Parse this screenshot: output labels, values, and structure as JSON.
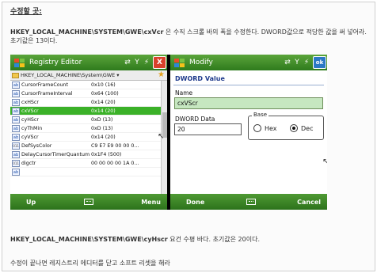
{
  "heading": "수정할 곳:",
  "para1_path": "HKEY_LOCAL_MACHINE\\SYSTEM\\GWE\\cxVcr",
  "para1_text": " 은 수직 스크롤 바의 폭을 수정한다. DWORD값으로 적당한 값을 써 넣어라. 초기값은 13이다.",
  "left_phone": {
    "title": "Registry Editor",
    "status_icons": [
      "⇄",
      "Y",
      "⚡"
    ],
    "close_label": "X",
    "path": "HKEY_LOCAL_MACHINE\\System\\GWE",
    "rows": [
      {
        "icon": "ab",
        "name": "CursorFrameCount",
        "value": "0x10 (16)",
        "selected": false
      },
      {
        "icon": "ab",
        "name": "CursorFrameInterval",
        "value": "0x64 (100)",
        "selected": false
      },
      {
        "icon": "ab",
        "name": "cxHScr",
        "value": "0x14 (20)",
        "selected": false
      },
      {
        "icon": "ab",
        "name": "cxVScr",
        "value": "0x14 (20)",
        "selected": true
      },
      {
        "icon": "ab",
        "name": "cyHScr",
        "value": "0xD (13)",
        "selected": false
      },
      {
        "icon": "ab",
        "name": "cyThMin",
        "value": "0xD (13)",
        "selected": false
      },
      {
        "icon": "ab",
        "name": "cyVScr",
        "value": "0x14 (20)",
        "selected": false
      },
      {
        "icon": "011",
        "name": "DefSysColor",
        "value": "C9 E7 E9 00 00 0...",
        "selected": false
      },
      {
        "icon": "ab",
        "name": "DelayCursorTimerQuantum",
        "value": "0x1F4 (500)",
        "selected": false
      },
      {
        "icon": "011",
        "name": "digctr",
        "value": "00 00 00 00 1A 0...",
        "selected": false
      },
      {
        "icon": "ab",
        "name": "",
        "value": "",
        "selected": false
      }
    ],
    "soft_left": "Up",
    "soft_right": "Menu"
  },
  "right_phone": {
    "title": "Modify",
    "status_icons": [
      "⇄",
      "Y",
      "⚡"
    ],
    "ok_label": "ok",
    "dialog_title": "DWORD Value",
    "name_label": "Name",
    "name_value": "cxVScr",
    "data_label": "DWORD Data",
    "data_value": "20",
    "base_label": "Base",
    "hex_label": "Hex",
    "dec_label": "Dec",
    "base_selected": "Dec",
    "soft_left": "Done",
    "soft_right": "Cancel"
  },
  "para2_path": "HKEY_LOCAL_MACHINE\\SYSTEM\\GWE\\cyHscr",
  "para2_text": " 요건 수평 바다. 초기값은 20이다.",
  "para3": "수정이 끝나면 레지스트리 에디터를 닫고 소프트 리셋을 해라",
  "colors": {
    "selection": "#3bb128",
    "titlebar": "#2f7b1d",
    "dialog_title": "#1f3b8c"
  }
}
